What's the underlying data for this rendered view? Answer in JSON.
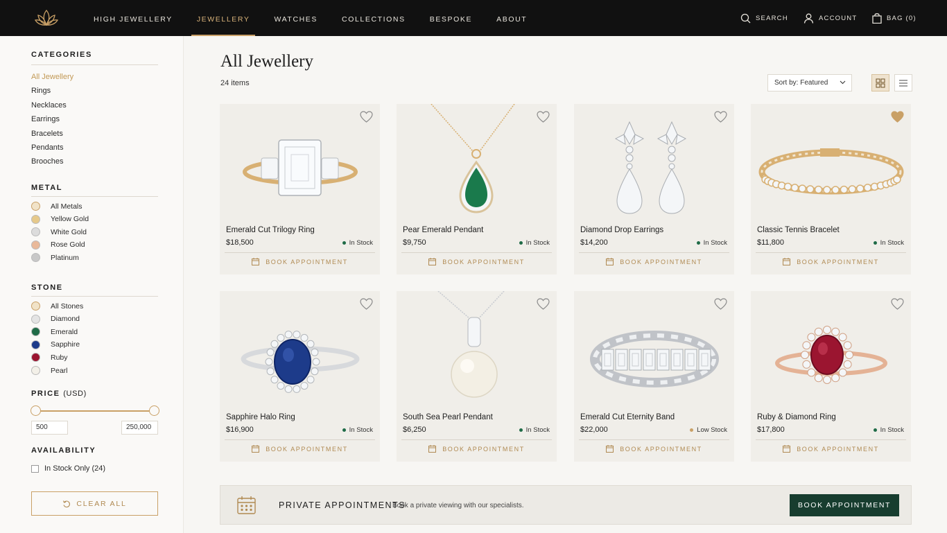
{
  "nav": {
    "items": [
      {
        "label": "HIGH JEWELLERY",
        "active": false
      },
      {
        "label": "JEWELLERY",
        "active": true
      },
      {
        "label": "WATCHES",
        "active": false
      },
      {
        "label": "COLLECTIONS",
        "active": false
      },
      {
        "label": "BESPOKE",
        "active": false
      },
      {
        "label": "ABOUT",
        "active": false
      }
    ],
    "search_label": "SEARCH",
    "account_label": "ACCOUNT",
    "bag_label": "BAG (0)"
  },
  "sidebar": {
    "categories_title": "CATEGORIES",
    "categories": [
      "All Jewellery",
      "Rings",
      "Necklaces",
      "Earrings",
      "Bracelets",
      "Pendants",
      "Brooches"
    ],
    "metal_title": "METAL",
    "metals": [
      {
        "label": "All Metals",
        "color": "#f1e3c8"
      },
      {
        "label": "Yellow Gold",
        "color": "#e6c98a"
      },
      {
        "label": "White Gold",
        "color": "#dcdcdc"
      },
      {
        "label": "Rose Gold",
        "color": "#e9b99a"
      },
      {
        "label": "Platinum",
        "color": "#c8c8c8"
      }
    ],
    "stone_title": "STONE",
    "stones": [
      {
        "label": "All Stones",
        "color": "#f1e3c8"
      },
      {
        "label": "Diamond",
        "color": "#e4e4e4"
      },
      {
        "label": "Emerald",
        "color": "#1f6b47"
      },
      {
        "label": "Sapphire",
        "color": "#1d3b8a"
      },
      {
        "label": "Ruby",
        "color": "#9b1530"
      },
      {
        "label": "Pearl",
        "color": "#f3f0e8"
      }
    ],
    "price_title": "PRICE",
    "price_unit": "(USD)",
    "price_min": "500",
    "price_max": "250,000",
    "availability_title": "AVAILABILITY",
    "in_stock_label": "In Stock Only (24)",
    "clear_label": "CLEAR ALL"
  },
  "main": {
    "title": "All Jewellery",
    "count": "24 items",
    "sort_label": "Sort by: Featured"
  },
  "products": [
    {
      "name": "Emerald Cut Trilogy Ring",
      "price": "$18,500",
      "stock": "In Stock",
      "stock_level": "in",
      "favorited": false,
      "art": "trilogy"
    },
    {
      "name": "Pear Emerald Pendant",
      "price": "$9,750",
      "stock": "In Stock",
      "stock_level": "in",
      "favorited": false,
      "art": "pear-pendant"
    },
    {
      "name": "Diamond Drop Earrings",
      "price": "$14,200",
      "stock": "In Stock",
      "stock_level": "in",
      "favorited": false,
      "art": "earrings"
    },
    {
      "name": "Classic Tennis Bracelet",
      "price": "$11,800",
      "stock": "In Stock",
      "stock_level": "in",
      "favorited": true,
      "art": "bracelet"
    },
    {
      "name": "Sapphire Halo Ring",
      "price": "$16,900",
      "stock": "In Stock",
      "stock_level": "in",
      "favorited": false,
      "art": "sapphire-ring"
    },
    {
      "name": "South Sea Pearl Pendant",
      "price": "$6,250",
      "stock": "In Stock",
      "stock_level": "in",
      "favorited": false,
      "art": "pearl"
    },
    {
      "name": "Emerald Cut Eternity Band",
      "price": "$22,000",
      "stock": "Low Stock",
      "stock_level": "low",
      "favorited": false,
      "art": "band"
    },
    {
      "name": "Ruby & Diamond Ring",
      "price": "$17,800",
      "stock": "In Stock",
      "stock_level": "in",
      "favorited": false,
      "art": "ruby-ring"
    }
  ],
  "book_label": "BOOK APPOINTMENT",
  "banner": {
    "title": "PRIVATE APPOINTMENTS",
    "subtitle": "Book a private viewing with our specialists.",
    "button": "BOOK APPOINTMENT"
  },
  "colors": {
    "accent": "#c9a066",
    "green": "#173d2f",
    "topbar": "#111111"
  }
}
